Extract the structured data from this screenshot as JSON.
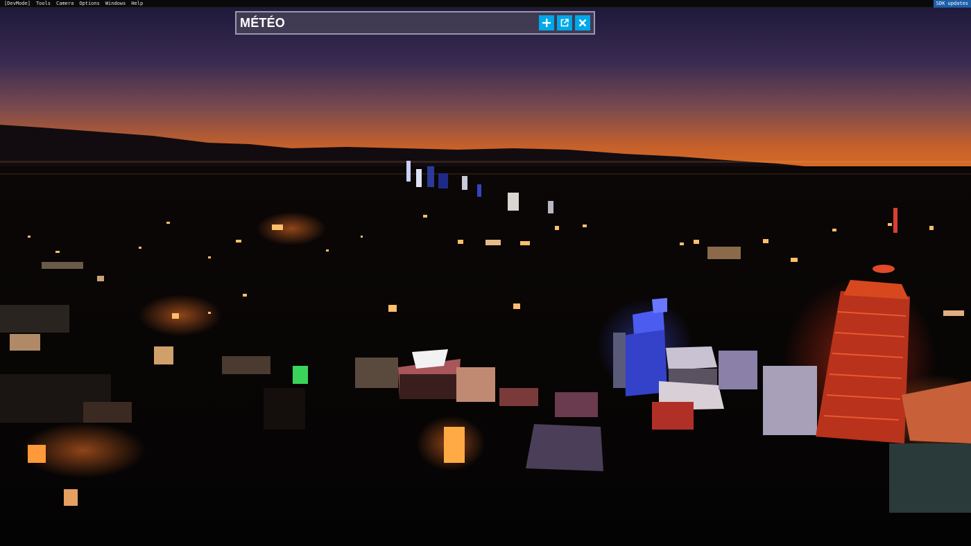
{
  "menubar": {
    "items": [
      {
        "label": "[DevMode]"
      },
      {
        "label": "Tools"
      },
      {
        "label": "Camera"
      },
      {
        "label": "Options"
      },
      {
        "label": "Windows"
      },
      {
        "label": "Help"
      }
    ],
    "sdk_label": "SDK updates"
  },
  "panel": {
    "title": "MÉTÉO",
    "buttons": [
      {
        "icon": "plus-icon"
      },
      {
        "icon": "external-window-icon"
      },
      {
        "icon": "close-icon"
      }
    ]
  },
  "colors": {
    "accent": "#00a8e8",
    "sdk_badge": "#1e5fa8",
    "menubar_bg": "#0a0a0a"
  }
}
